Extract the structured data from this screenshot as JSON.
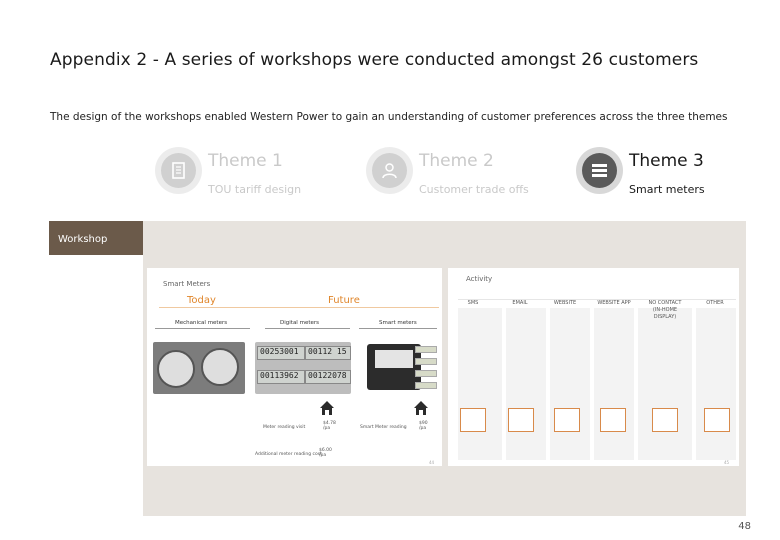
{
  "title": "Appendix 2 - A series of workshops were conducted amongst 26 customers",
  "subtitle": "The design of the workshops enabled Western Power to gain an understanding of customer preferences across the three themes",
  "themes": [
    {
      "title": "Theme 1",
      "subtitle": "TOU tariff design",
      "icon": "document-icon",
      "active": false
    },
    {
      "title": "Theme 2",
      "subtitle": "Customer trade offs",
      "icon": "person-icon",
      "active": false
    },
    {
      "title": "Theme 3",
      "subtitle": "Smart meters",
      "icon": "list-icon",
      "active": true
    }
  ],
  "workshop_label": "Workshop",
  "slide1": {
    "heading": "Smart Meters",
    "today": "Today",
    "future": "Future",
    "label_today": "Mechanical meters",
    "label_digital": "Digital meters",
    "label_smart": "Smart meters",
    "lcd": [
      "00253001",
      "00112 15",
      "00113962",
      "00122078"
    ],
    "note1": "Meter reading visit",
    "note2": "Smart Meter reading",
    "note3": "Additional meter reading cost",
    "price1": "$4.78 /pa",
    "price2": "$90 /pa",
    "price3": "$6.00 /pa",
    "slide_no": "44"
  },
  "slide2": {
    "heading": "Activity",
    "columns": [
      "SMS",
      "EMAIL",
      "WEBSITE",
      "WEBSITE APP",
      "NO CONTACT (IN-HOME DISPLAY)",
      "OTHER"
    ],
    "slide_no": "45"
  },
  "page_number": "48",
  "colors": {
    "tab": "#6b5a4a",
    "panel": "#e7e3de",
    "accent": "#e0862b"
  }
}
